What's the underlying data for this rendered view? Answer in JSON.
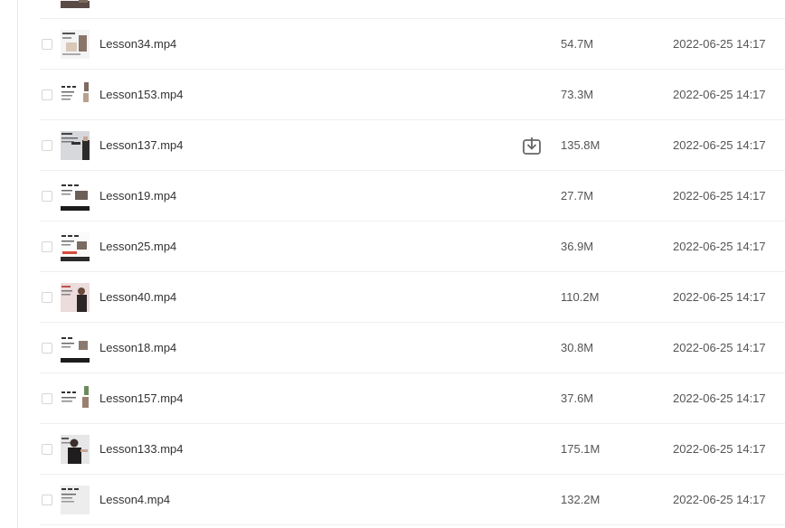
{
  "files": [
    {
      "name": "",
      "size": "",
      "date": "",
      "thumb": "dark",
      "partial": true
    },
    {
      "name": "Lesson34.mp4",
      "size": "54.7M",
      "date": "2022-06-25 14:17",
      "thumb": "slide"
    },
    {
      "name": "Lesson153.mp4",
      "size": "73.3M",
      "date": "2022-06-25 14:17",
      "thumb": "text-white"
    },
    {
      "name": "Lesson137.mp4",
      "size": "135.8M",
      "date": "2022-06-25 14:17",
      "thumb": "person-gray",
      "show_download": true
    },
    {
      "name": "Lesson19.mp4",
      "size": "27.7M",
      "date": "2022-06-25 14:17",
      "thumb": "dark-bar"
    },
    {
      "name": "Lesson25.mp4",
      "size": "36.9M",
      "date": "2022-06-25 14:17",
      "thumb": "slide-red"
    },
    {
      "name": "Lesson40.mp4",
      "size": "110.2M",
      "date": "2022-06-25 14:17",
      "thumb": "person-pink"
    },
    {
      "name": "Lesson18.mp4",
      "size": "30.8M",
      "date": "2022-06-25 14:17",
      "thumb": "dark-bar"
    },
    {
      "name": "Lesson157.mp4",
      "size": "37.6M",
      "date": "2022-06-25 14:17",
      "thumb": "text-white"
    },
    {
      "name": "Lesson133.mp4",
      "size": "175.1M",
      "date": "2022-06-25 14:17",
      "thumb": "person-dark"
    },
    {
      "name": "Lesson4.mp4",
      "size": "132.2M",
      "date": "2022-06-25 14:17",
      "thumb": "text-gray"
    }
  ],
  "icons": {
    "download": "download-icon",
    "thumbnail": "video-thumbnail"
  },
  "colors": {
    "text": "#333333",
    "secondary_text": "#555555",
    "divider": "#efefef",
    "checkbox_border": "#d6d6d6",
    "icon": "#666666"
  }
}
